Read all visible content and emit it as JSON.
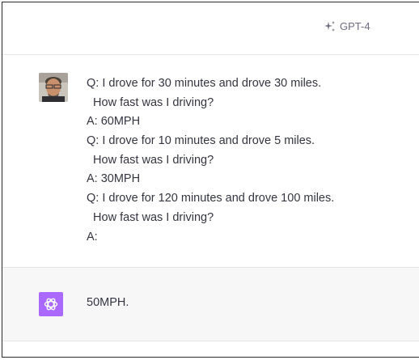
{
  "header": {
    "model_label": "GPT-4",
    "model_icon": "sparkle-icon"
  },
  "user_message": {
    "avatar": "user-avatar-photo",
    "lines": [
      "Q: I drove for 30 minutes and drove 30 miles.",
      "  How fast was I driving?",
      "A: 60MPH",
      "Q: I drove for 10 minutes and drove 5 miles.",
      "  How fast was I driving?",
      "A: 30MPH",
      "Q: I drove for 120 minutes and drove 100 miles.",
      "  How fast was I driving?",
      "A:"
    ]
  },
  "assistant_message": {
    "avatar": "openai-logo-icon",
    "avatar_color": "#ab68ff",
    "text": "50MPH."
  }
}
